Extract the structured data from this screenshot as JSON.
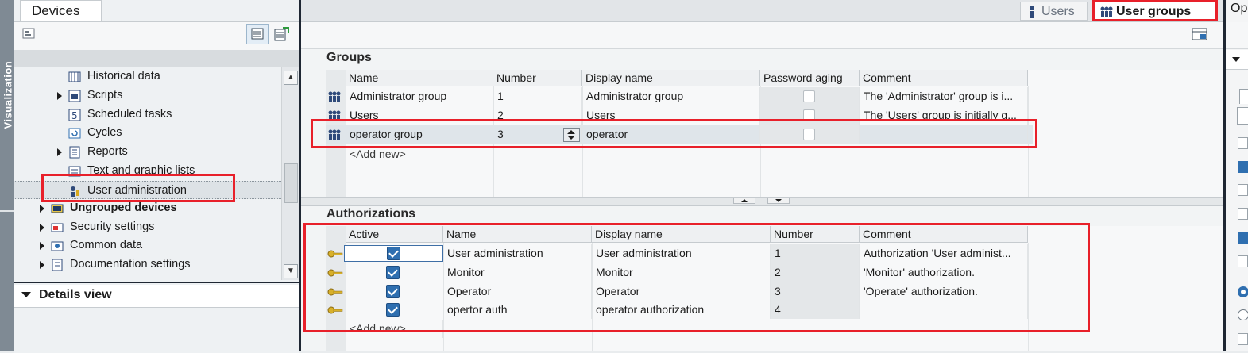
{
  "left_panel": {
    "strip_label": "Visualization",
    "tab": "Devices",
    "tree": [
      {
        "label": "Historical data",
        "indent": 2,
        "expandable": false,
        "icon": "historical-data-icon"
      },
      {
        "label": "Scripts",
        "indent": 2,
        "expandable": true,
        "icon": "scripts-icon"
      },
      {
        "label": "Scheduled tasks",
        "indent": 2,
        "expandable": false,
        "icon": "scheduled-tasks-icon"
      },
      {
        "label": "Cycles",
        "indent": 2,
        "expandable": false,
        "icon": "cycles-icon"
      },
      {
        "label": "Reports",
        "indent": 2,
        "expandable": true,
        "icon": "reports-icon"
      },
      {
        "label": "Text and graphic lists",
        "indent": 2,
        "expandable": false,
        "icon": "text-graphic-lists-icon"
      },
      {
        "label": "User administration",
        "indent": 2,
        "expandable": false,
        "icon": "user-administration-icon",
        "selected": true
      },
      {
        "label": "Ungrouped devices",
        "indent": 1,
        "expandable": true,
        "icon": "ungrouped-devices-icon",
        "bold": true
      },
      {
        "label": "Security settings",
        "indent": 1,
        "expandable": true,
        "icon": "security-settings-icon"
      },
      {
        "label": "Common data",
        "indent": 1,
        "expandable": true,
        "icon": "common-data-icon"
      },
      {
        "label": "Documentation settings",
        "indent": 1,
        "expandable": true,
        "icon": "documentation-settings-icon"
      }
    ],
    "details_view": "Details view"
  },
  "top_tabs": {
    "users": "Users",
    "user_groups": "User groups",
    "right_cut": "Op"
  },
  "groups": {
    "title": "Groups",
    "columns": [
      "Name",
      "Number",
      "Display name",
      "Password aging",
      "Comment"
    ],
    "rows": [
      {
        "name": "Administrator group",
        "number": "1",
        "display_name": "Administrator group",
        "password_aging": false,
        "comment": "The 'Administrator' group is i..."
      },
      {
        "name": "Users",
        "number": "2",
        "display_name": "Users",
        "password_aging": false,
        "comment": "The 'Users' group is initially g..."
      },
      {
        "name": "operator group",
        "number": "3",
        "display_name": "operator",
        "password_aging": false,
        "comment": ""
      }
    ],
    "add_new": "<Add new>"
  },
  "authorizations": {
    "title": "Authorizations",
    "columns": [
      "Active",
      "Name",
      "Display name",
      "Number",
      "Comment"
    ],
    "rows": [
      {
        "active": true,
        "name": "User administration",
        "display_name": "User administration",
        "number": "1",
        "comment": "Authorization 'User administ..."
      },
      {
        "active": true,
        "name": "Monitor",
        "display_name": "Monitor",
        "number": "2",
        "comment": "'Monitor' authorization."
      },
      {
        "active": true,
        "name": "Operator",
        "display_name": "Operator",
        "number": "3",
        "comment": "'Operate' authorization."
      },
      {
        "active": true,
        "name": "opertor auth",
        "display_name": "operator authorization",
        "number": "4",
        "comment": ""
      }
    ],
    "add_new": "<Add new>"
  },
  "colors": {
    "highlight": "#e8202a",
    "checkbox": "#2f6fb0"
  }
}
